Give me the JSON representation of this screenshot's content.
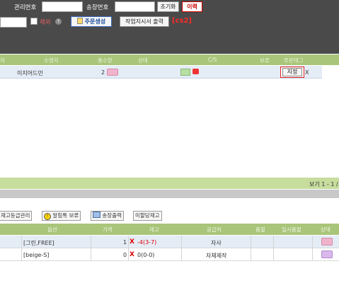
{
  "search": {
    "mgmt_no_label": "관리번호",
    "invoice_no_label": "송장번호",
    "reset_label": "초기화",
    "history_label": "이력",
    "exclude_label": "제외",
    "create_order_label": "주문생성",
    "print_work_order_label": "작업지시서 출력",
    "cs_tag": "[cs2]"
  },
  "order_table": {
    "headers": [
      "수령자",
      "총수량",
      "상태",
      "C/S",
      "보류",
      "주문태그"
    ],
    "first_header_fragment": "자",
    "rows": [
      {
        "recipient": "이지어드민",
        "qty": "2",
        "tag_button": "지정",
        "tag_x": "X"
      }
    ],
    "footer": "보기 1 - 1 /"
  },
  "toolbar": {
    "stock_grade_label": "재고등급관리",
    "alimtalk_hold_label": "알림톡 보류",
    "invoice_output_label": "송장출력",
    "unassigned_stock_label": "미할당재고"
  },
  "product_table": {
    "headers": [
      "옵션",
      "가격",
      "재고",
      "공급처",
      "품절",
      "일시품절",
      "상태"
    ],
    "rows": [
      {
        "option": "[그린,FREE]",
        "price": "1",
        "mark": "X",
        "stock": "-4(3-7)",
        "supplier": "자사"
      },
      {
        "option": "[beige-S]",
        "price": "0",
        "mark": "X",
        "stock": "0(0-0)",
        "supplier": "자체제작"
      }
    ]
  },
  "colors": {
    "header_green": "#a9c57a",
    "dark_bar": "#4a4a4a",
    "accent_red": "#e02020"
  }
}
